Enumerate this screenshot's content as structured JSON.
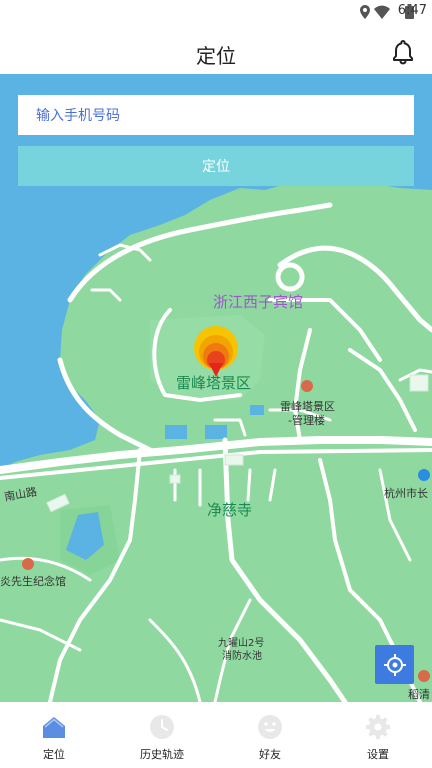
{
  "status": {
    "time": "6:47",
    "icons": [
      "location-icon",
      "wifi-icon",
      "battery-icon"
    ]
  },
  "header": {
    "title": "定位",
    "bell_icon": "bell-icon"
  },
  "form": {
    "phone_placeholder": "输入手机号码",
    "phone_value": "",
    "locate_label": "定位"
  },
  "map": {
    "labels": {
      "hotel": "浙江西子宾馆",
      "leifeng": "雷峰塔景区",
      "leifeng_mgmt_1": "雷峰塔景区",
      "leifeng_mgmt_2": "-管理楼",
      "jingci": "净慈寺",
      "nanshan": "南山路",
      "memorial": "炎先生纪念馆",
      "hangzhou": "杭州市长",
      "jiuyao_1": "九曜山2号",
      "jiuyao_2": "消防水池",
      "corner": "稻清"
    },
    "colors": {
      "water": "#5bb3e4",
      "land": "#8fd9a0",
      "road": "#ffffff",
      "accent": "#3e7be0"
    }
  },
  "tabs": [
    {
      "label": "定位",
      "icon": "home-icon",
      "active": true
    },
    {
      "label": "历史轨迹",
      "icon": "clock-icon",
      "active": false
    },
    {
      "label": "好友",
      "icon": "smile-icon",
      "active": false
    },
    {
      "label": "设置",
      "icon": "gear-icon",
      "active": false
    }
  ]
}
